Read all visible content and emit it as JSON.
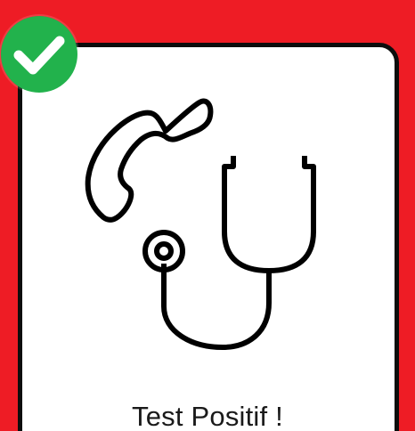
{
  "caption": "Test Positif !",
  "icons": {
    "badge": "checkmark-icon",
    "phone": "telephone-handset-icon",
    "stethoscope": "stethoscope-icon"
  },
  "colors": {
    "background": "#ee1c25",
    "card": "#ffffff",
    "border": "#0d0d0d",
    "badge": "#22b24c",
    "check": "#ffffff",
    "line_art": "#000000"
  }
}
